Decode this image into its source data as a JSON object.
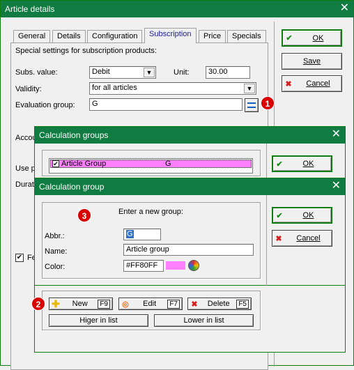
{
  "main_window": {
    "title": "Article details",
    "tabs": [
      "General",
      "Details",
      "Configuration",
      "Subscription",
      "Price",
      "Specials"
    ],
    "active_tab": "Subscription",
    "description": "Special settings for subscription products:",
    "subs_value_label": "Subs. value:",
    "subs_value": "Debit",
    "unit_label": "Unit:",
    "unit_value": "30.00",
    "validity_label": "Validity:",
    "validity_value": "for all articles",
    "eval_group_label": "Evaluation group:",
    "eval_group_value": "G",
    "hidden_label_1": "Accou",
    "hidden_label_2": "Use p",
    "hidden_label_3": "Durati",
    "checkbox_fe_label": "Fe",
    "ok_label": "OK",
    "save_label": "Save",
    "cancel_label": "Cancel"
  },
  "calc_groups_window": {
    "title": "Calculation groups",
    "list_item_name": "Article Group",
    "list_item_abbr": "G",
    "ok_label": "OK",
    "new_label": "New",
    "new_key": "F9",
    "edit_label": "Edit",
    "edit_key": "F7",
    "delete_label": "Delete",
    "delete_key": "F5",
    "higher_label": "Higer in list",
    "lower_label": "Lower in list"
  },
  "calc_group_window": {
    "title": "Calculation group",
    "prompt": "Enter a new group:",
    "abbr_label": "Abbr.:",
    "abbr_value": "G",
    "name_label": "Name:",
    "name_value": "Article group",
    "color_label": "Color:",
    "color_value": "#FF80FF",
    "ok_label": "OK",
    "cancel_label": "Cancel"
  },
  "badges": {
    "b1": "1",
    "b2": "2",
    "b3": "3"
  },
  "colors": {
    "title_green": "#107c41",
    "swatch": "#FF80FF",
    "badge_red": "#d80000"
  }
}
